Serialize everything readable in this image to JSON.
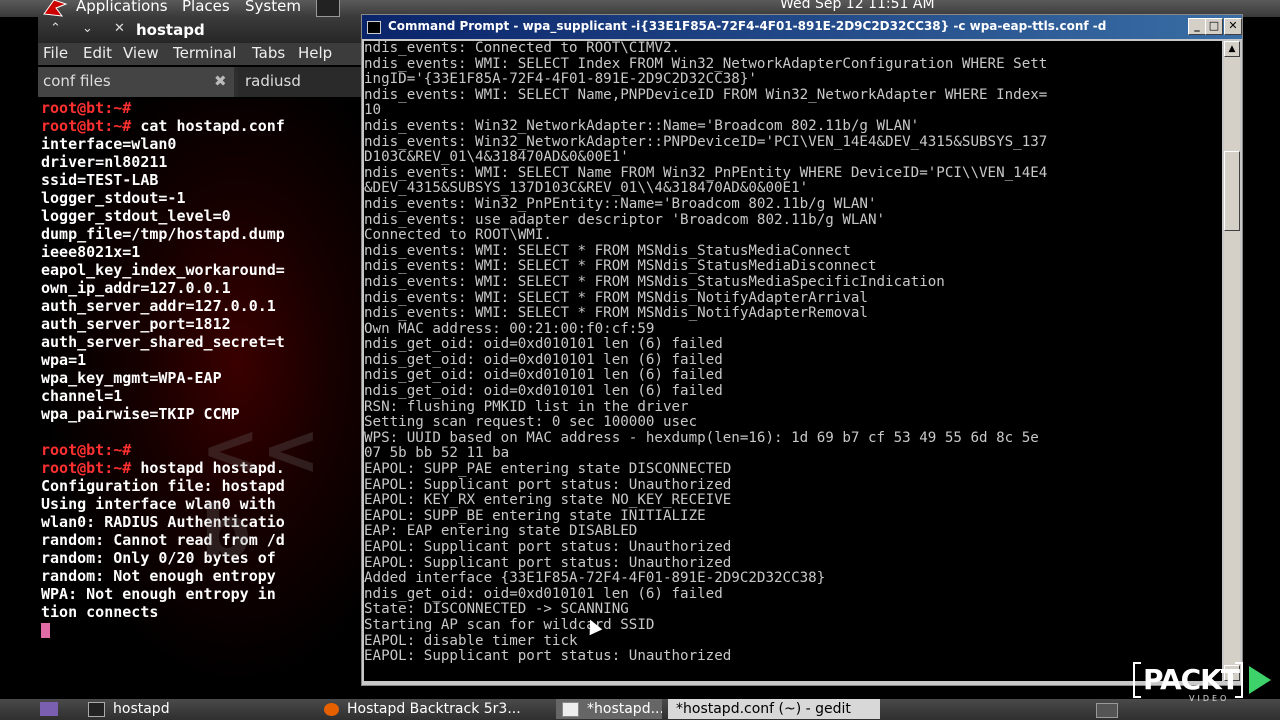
{
  "top_panel": {
    "menus": [
      "Applications",
      "Places",
      "System"
    ],
    "clock": "Wed Sep 12 11:51 AM"
  },
  "terminal": {
    "title": "hostapd",
    "menu": [
      "File",
      "Edit",
      "View",
      "Terminal",
      "Tabs",
      "Help"
    ],
    "tabs": [
      "conf files",
      "radiusd"
    ],
    "lines": [
      {
        "prompt": "root@bt:~#",
        "text": ""
      },
      {
        "prompt": "root@bt:~#",
        "text": " cat hostapd.conf"
      },
      {
        "prompt": "",
        "text": "interface=wlan0"
      },
      {
        "prompt": "",
        "text": "driver=nl80211"
      },
      {
        "prompt": "",
        "text": "ssid=TEST-LAB"
      },
      {
        "prompt": "",
        "text": "logger_stdout=-1"
      },
      {
        "prompt": "",
        "text": "logger_stdout_level=0"
      },
      {
        "prompt": "",
        "text": "dump_file=/tmp/hostapd.dump"
      },
      {
        "prompt": "",
        "text": "ieee8021x=1"
      },
      {
        "prompt": "",
        "text": "eapol_key_index_workaround="
      },
      {
        "prompt": "",
        "text": "own_ip_addr=127.0.0.1"
      },
      {
        "prompt": "",
        "text": "auth_server_addr=127.0.0.1"
      },
      {
        "prompt": "",
        "text": "auth_server_port=1812"
      },
      {
        "prompt": "",
        "text": "auth_server_shared_secret=t"
      },
      {
        "prompt": "",
        "text": "wpa=1"
      },
      {
        "prompt": "",
        "text": "wpa_key_mgmt=WPA-EAP"
      },
      {
        "prompt": "",
        "text": "channel=1"
      },
      {
        "prompt": "",
        "text": "wpa_pairwise=TKIP CCMP"
      },
      {
        "prompt": "",
        "text": ""
      },
      {
        "prompt": "root@bt:~#",
        "text": ""
      },
      {
        "prompt": "root@bt:~#",
        "text": " hostapd hostapd."
      },
      {
        "prompt": "",
        "text": "Configuration file: hostapd"
      },
      {
        "prompt": "",
        "text": "Using interface wlan0 with"
      },
      {
        "prompt": "",
        "text": "wlan0: RADIUS Authenticatio"
      },
      {
        "prompt": "",
        "text": "random: Cannot read from /d"
      },
      {
        "prompt": "",
        "text": "random: Only 0/20 bytes of"
      },
      {
        "prompt": "",
        "text": "random: Not enough entropy"
      },
      {
        "prompt": "",
        "text": "WPA: Not enough entropy in"
      },
      {
        "prompt": "",
        "text": "tion connects"
      }
    ],
    "watermark": "<< b"
  },
  "cmd": {
    "title": "Command Prompt - wpa_supplicant -i{33E1F85A-72F4-4F01-891E-2D9C2D32CC38} -c wpa-eap-ttls.conf -d",
    "lines": [
      "ndis_events: Connected to ROOT\\CIMV2.",
      "ndis_events: WMI: SELECT Index FROM Win32_NetworkAdapterConfiguration WHERE Sett",
      "ingID='{33E1F85A-72F4-4F01-891E-2D9C2D32CC38}'",
      "ndis_events: WMI: SELECT Name,PNPDeviceID FROM Win32_NetworkAdapter WHERE Index=",
      "10",
      "ndis_events: Win32_NetworkAdapter::Name='Broadcom 802.11b/g WLAN'",
      "ndis_events: Win32_NetworkAdapter::PNPDeviceID='PCI\\VEN_14E4&DEV_4315&SUBSYS_137",
      "D103C&REV_01\\4&318470AD&0&00E1'",
      "ndis_events: WMI: SELECT Name FROM Win32_PnPEntity WHERE DeviceID='PCI\\\\VEN_14E4",
      "&DEV_4315&SUBSYS_137D103C&REV_01\\\\4&318470AD&0&00E1'",
      "ndis_events: Win32_PnPEntity::Name='Broadcom 802.11b/g WLAN'",
      "ndis_events: use adapter descriptor 'Broadcom 802.11b/g WLAN'",
      "Connected to ROOT\\WMI.",
      "ndis_events: WMI: SELECT * FROM MSNdis_StatusMediaConnect",
      "ndis_events: WMI: SELECT * FROM MSNdis_StatusMediaDisconnect",
      "ndis_events: WMI: SELECT * FROM MSNdis_StatusMediaSpecificIndication",
      "ndis_events: WMI: SELECT * FROM MSNdis_NotifyAdapterArrival",
      "ndis_events: WMI: SELECT * FROM MSNdis_NotifyAdapterRemoval",
      "Own MAC address: 00:21:00:f0:cf:59",
      "ndis_get_oid: oid=0xd010101 len (6) failed",
      "ndis_get_oid: oid=0xd010101 len (6) failed",
      "ndis_get_oid: oid=0xd010101 len (6) failed",
      "ndis_get_oid: oid=0xd010101 len (6) failed",
      "RSN: flushing PMKID list in the driver",
      "Setting scan request: 0 sec 100000 usec",
      "WPS: UUID based on MAC address - hexdump(len=16): 1d 69 b7 cf 53 49 55 6d 8c 5e",
      "07 5b bb 52 11 ba",
      "EAPOL: SUPP_PAE entering state DISCONNECTED",
      "EAPOL: Supplicant port status: Unauthorized",
      "EAPOL: KEY_RX entering state NO_KEY_RECEIVE",
      "EAPOL: SUPP_BE entering state INITIALIZE",
      "EAP: EAP entering state DISABLED",
      "EAPOL: Supplicant port status: Unauthorized",
      "EAPOL: Supplicant port status: Unauthorized",
      "Added interface {33E1F85A-72F4-4F01-891E-2D9C2D32CC38}",
      "ndis_get_oid: oid=0xd010101 len (6) failed",
      "State: DISCONNECTED -> SCANNING",
      "Starting AP scan for wildcard SSID",
      "EAPOL: disable timer tick",
      "EAPOL: Supplicant port status: Unauthorized"
    ]
  },
  "taskbar": {
    "items": [
      {
        "label": "hostapd",
        "icon": "terminal-icon"
      },
      {
        "label": "Hostapd Backtrack 5r3...",
        "icon": "firefox-icon"
      },
      {
        "label": "*hostapd...",
        "icon": "gedit-icon"
      },
      {
        "label": "*hostapd.conf (~) - gedit",
        "icon": ""
      }
    ]
  },
  "watermark": {
    "brand": "PACKT",
    "sub": "VIDEO",
    "accent": "#3ed36a"
  }
}
